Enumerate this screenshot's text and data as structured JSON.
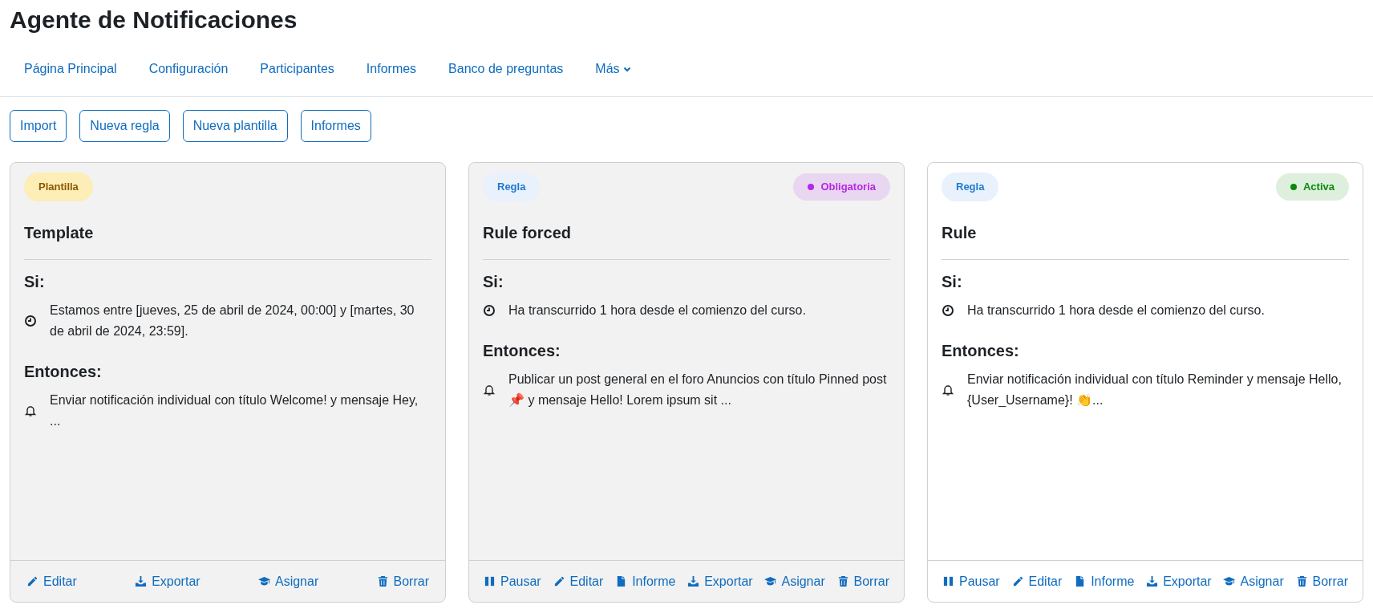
{
  "page_title": "Agente de Notificaciones",
  "nav": [
    {
      "label": "Página Principal",
      "kind": "link"
    },
    {
      "label": "Configuración",
      "kind": "link"
    },
    {
      "label": "Participantes",
      "kind": "link"
    },
    {
      "label": "Informes",
      "kind": "link"
    },
    {
      "label": "Banco de preguntas",
      "kind": "link"
    },
    {
      "label": "Más",
      "kind": "dropdown"
    }
  ],
  "toolbar": [
    "Import",
    "Nueva regla",
    "Nueva plantilla",
    "Informes"
  ],
  "cards": [
    {
      "type_badge": {
        "label": "Plantilla",
        "kind": "template"
      },
      "active": false,
      "title": "Template",
      "if_label": "Si:",
      "conditions": [
        "Estamos entre [jueves, 25 de abril de 2024, 00:00] y [martes, 30 de abril de 2024, 23:59]."
      ],
      "then_label": "Entonces:",
      "actions": [
        "Enviar notificación individual con título Welcome! y mensaje Hey, ..."
      ],
      "footer": [
        {
          "label": "Editar",
          "kind": "edit"
        },
        {
          "label": "Exportar",
          "kind": "export"
        },
        {
          "label": "Asignar",
          "kind": "assign"
        },
        {
          "label": "Borrar",
          "kind": "delete"
        }
      ]
    },
    {
      "type_badge": {
        "label": "Regla",
        "kind": "rule"
      },
      "status": {
        "label": "Obligatoria",
        "color": "#b627e6"
      },
      "active": false,
      "title": "Rule forced",
      "if_label": "Si:",
      "conditions": [
        "Ha transcurrido 1 hora desde el comienzo del curso."
      ],
      "then_label": "Entonces:",
      "actions": [
        "Publicar un post general en el foro Anuncios con título Pinned post 📌 y mensaje Hello! Lorem ipsum sit ..."
      ],
      "footer": [
        {
          "label": "Pausar",
          "kind": "pause"
        },
        {
          "label": "Editar",
          "kind": "edit"
        },
        {
          "label": "Informe",
          "kind": "report"
        },
        {
          "label": "Exportar",
          "kind": "export"
        },
        {
          "label": "Asignar",
          "kind": "assign"
        },
        {
          "label": "Borrar",
          "kind": "delete"
        }
      ]
    },
    {
      "type_badge": {
        "label": "Regla",
        "kind": "rule"
      },
      "status": {
        "label": "Activa",
        "color": "#0a8a0a"
      },
      "active": true,
      "title": "Rule",
      "if_label": "Si:",
      "conditions": [
        "Ha transcurrido 1 hora desde el comienzo del curso."
      ],
      "then_label": "Entonces:",
      "actions": [
        "Enviar notificación individual con título Reminder y mensaje Hello, {User_Username}! 👏..."
      ],
      "footer": [
        {
          "label": "Pausar",
          "kind": "pause"
        },
        {
          "label": "Editar",
          "kind": "edit"
        },
        {
          "label": "Informe",
          "kind": "report"
        },
        {
          "label": "Exportar",
          "kind": "export"
        },
        {
          "label": "Asignar",
          "kind": "assign"
        },
        {
          "label": "Borrar",
          "kind": "delete"
        }
      ]
    }
  ]
}
